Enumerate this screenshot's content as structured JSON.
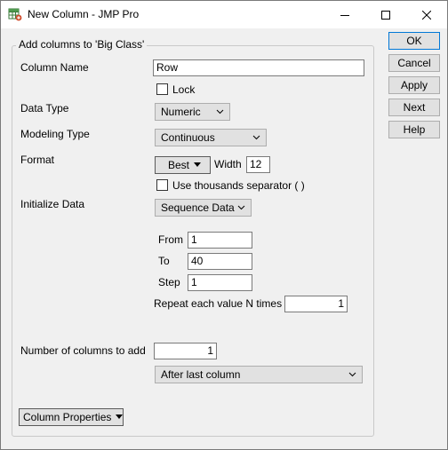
{
  "window": {
    "title": "New Column - JMP Pro"
  },
  "group": {
    "legend": "Add columns to 'Big Class'"
  },
  "fields": {
    "column_name_label": "Column Name",
    "column_name_value": "Row",
    "lock_label": "Lock",
    "data_type_label": "Data Type",
    "data_type_value": "Numeric",
    "modeling_type_label": "Modeling Type",
    "modeling_type_value": "Continuous",
    "format_label": "Format",
    "format_value": "Best",
    "width_label": "Width",
    "width_value": "12",
    "thousands_label": "Use thousands separator ( )",
    "initialize_label": "Initialize Data",
    "initialize_value": "Sequence Data",
    "from_label": "From",
    "from_value": "1",
    "to_label": "To",
    "to_value": "40",
    "step_label": "Step",
    "step_value": "1",
    "repeat_label": "Repeat each value N times",
    "repeat_value": "1",
    "num_columns_label": "Number of columns to add",
    "num_columns_value": "1",
    "position_value": "After last column",
    "column_properties_label": "Column Properties"
  },
  "buttons": {
    "ok": "OK",
    "cancel": "Cancel",
    "apply": "Apply",
    "next": "Next",
    "help": "Help"
  },
  "checkbox_state": {
    "lock": false,
    "thousands": false
  },
  "icons": {
    "app": "jmp-table-icon",
    "minimize": "minimize-icon",
    "maximize": "maximize-icon",
    "close": "close-icon"
  },
  "colors": {
    "default_button_border": "#0078d7",
    "window_bg": "#f0f0f0"
  }
}
